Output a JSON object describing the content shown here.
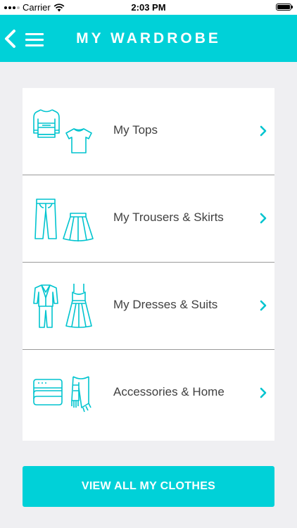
{
  "status_bar": {
    "carrier": "Carrier",
    "time": "2:03 PM"
  },
  "header": {
    "title": "MY WARDROBE"
  },
  "colors": {
    "accent": "#00d1d8",
    "text": "#404040",
    "divider": "#9a9a9a"
  },
  "categories": [
    {
      "label": "My Tops",
      "icons": [
        "sweater-icon",
        "tshirt-icon"
      ]
    },
    {
      "label": "My Trousers & Skirts",
      "icons": [
        "trousers-icon",
        "skirt-icon"
      ]
    },
    {
      "label": "My Dresses & Suits",
      "icons": [
        "suit-icon",
        "dress-icon"
      ]
    },
    {
      "label": "Accessories & Home",
      "icons": [
        "folded-towel-icon",
        "scarf-icon"
      ]
    }
  ],
  "view_all_button": {
    "label": "VIEW ALL MY CLOTHES"
  }
}
